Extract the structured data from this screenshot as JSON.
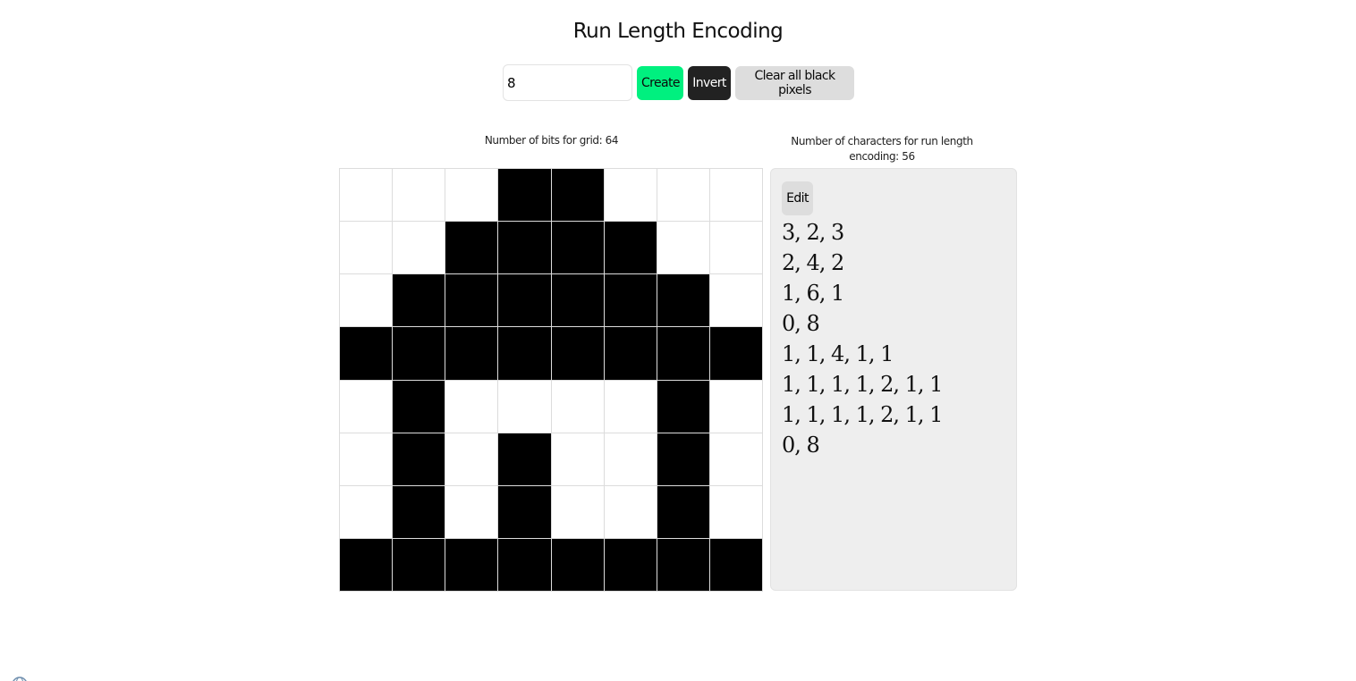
{
  "header": {
    "title": "Run Length Encoding"
  },
  "controls": {
    "size_value": "8",
    "create_label": "Create",
    "invert_label": "Invert",
    "clear_label": "Clear all black pixels"
  },
  "grid": {
    "caption": "Number of bits for grid: 64",
    "size": 8,
    "rows": [
      [
        0,
        0,
        0,
        1,
        1,
        0,
        0,
        0
      ],
      [
        0,
        0,
        1,
        1,
        1,
        1,
        0,
        0
      ],
      [
        0,
        1,
        1,
        1,
        1,
        1,
        1,
        0
      ],
      [
        1,
        1,
        1,
        1,
        1,
        1,
        1,
        1
      ],
      [
        0,
        1,
        0,
        0,
        0,
        0,
        1,
        0
      ],
      [
        0,
        1,
        0,
        1,
        0,
        0,
        1,
        0
      ],
      [
        0,
        1,
        0,
        1,
        0,
        0,
        1,
        0
      ],
      [
        1,
        1,
        1,
        1,
        1,
        1,
        1,
        1
      ]
    ]
  },
  "rle": {
    "caption": "Number of characters for run length encoding: 56",
    "edit_label": "Edit",
    "lines": [
      "3, 2, 3",
      "2, 4, 2",
      "1, 6, 1",
      "0, 8",
      "1, 1, 4, 1, 1",
      "1, 1, 1, 1, 2, 1, 1",
      "1, 1, 1, 1, 2, 1, 1",
      "0, 8"
    ]
  },
  "colors": {
    "create_button": "#00f07f",
    "invert_button": "#222222",
    "clear_button": "#dddddd",
    "pixel_on": "#000000",
    "pixel_off": "#ffffff",
    "panel_bg": "#eeeeee"
  },
  "icons": {
    "corner": "globe-icon"
  }
}
